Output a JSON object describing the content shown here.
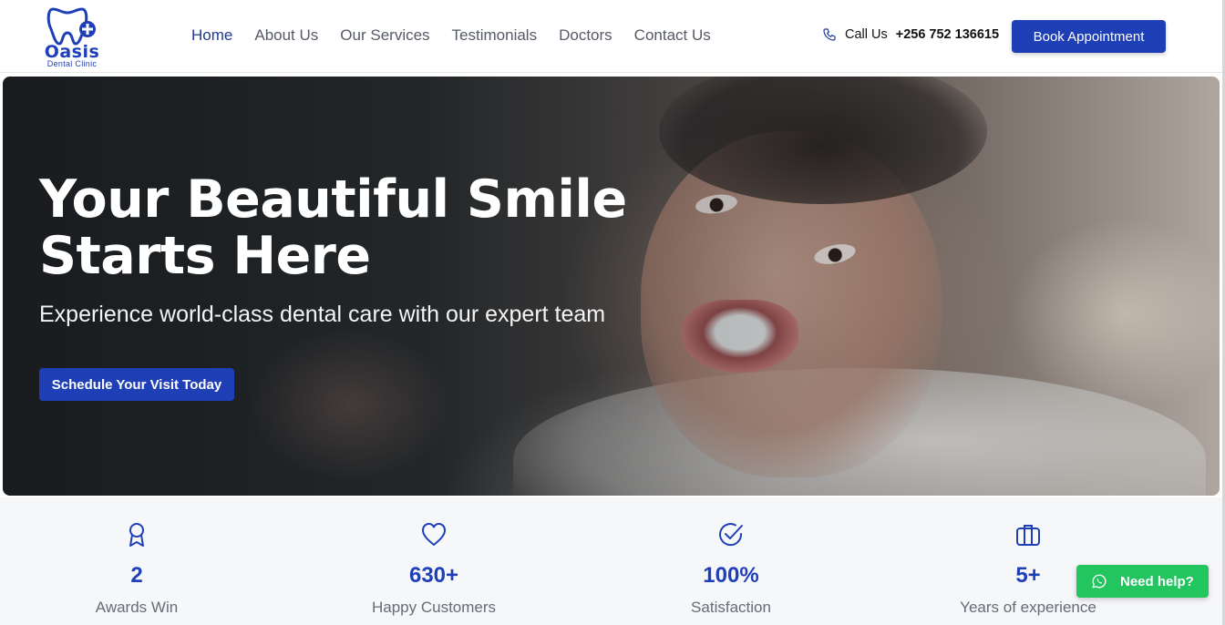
{
  "brand": {
    "name": "Oasis",
    "tagline": "Dental Clinic",
    "accent": "#1e3fb5",
    "whatsapp_color": "#22c55e"
  },
  "nav": {
    "items": [
      {
        "label": "Home",
        "active": true
      },
      {
        "label": "About Us",
        "active": false
      },
      {
        "label": "Our Services",
        "active": false
      },
      {
        "label": "Testimonials",
        "active": false
      },
      {
        "label": "Doctors",
        "active": false
      },
      {
        "label": "Contact Us",
        "active": false
      }
    ],
    "call_label": "Call Us",
    "phone": "+256 752 136615",
    "phone_icon": "phone-icon",
    "book_label": "Book Appointment"
  },
  "hero": {
    "title_line1": "Your Beautiful Smile",
    "title_line2": "Starts Here",
    "subtitle": "Experience world-class dental care with our expert team",
    "cta": "Schedule Your Visit Today"
  },
  "stats": [
    {
      "icon": "award-icon",
      "value": "2",
      "label": "Awards Win"
    },
    {
      "icon": "heart-icon",
      "value": "630+",
      "label": "Happy Customers"
    },
    {
      "icon": "check-circle-icon",
      "value": "100%",
      "label": "Satisfaction"
    },
    {
      "icon": "briefcase-icon",
      "value": "5+",
      "label": "Years of experience"
    }
  ],
  "help": {
    "label": "Need help?",
    "icon": "whatsapp-icon"
  }
}
